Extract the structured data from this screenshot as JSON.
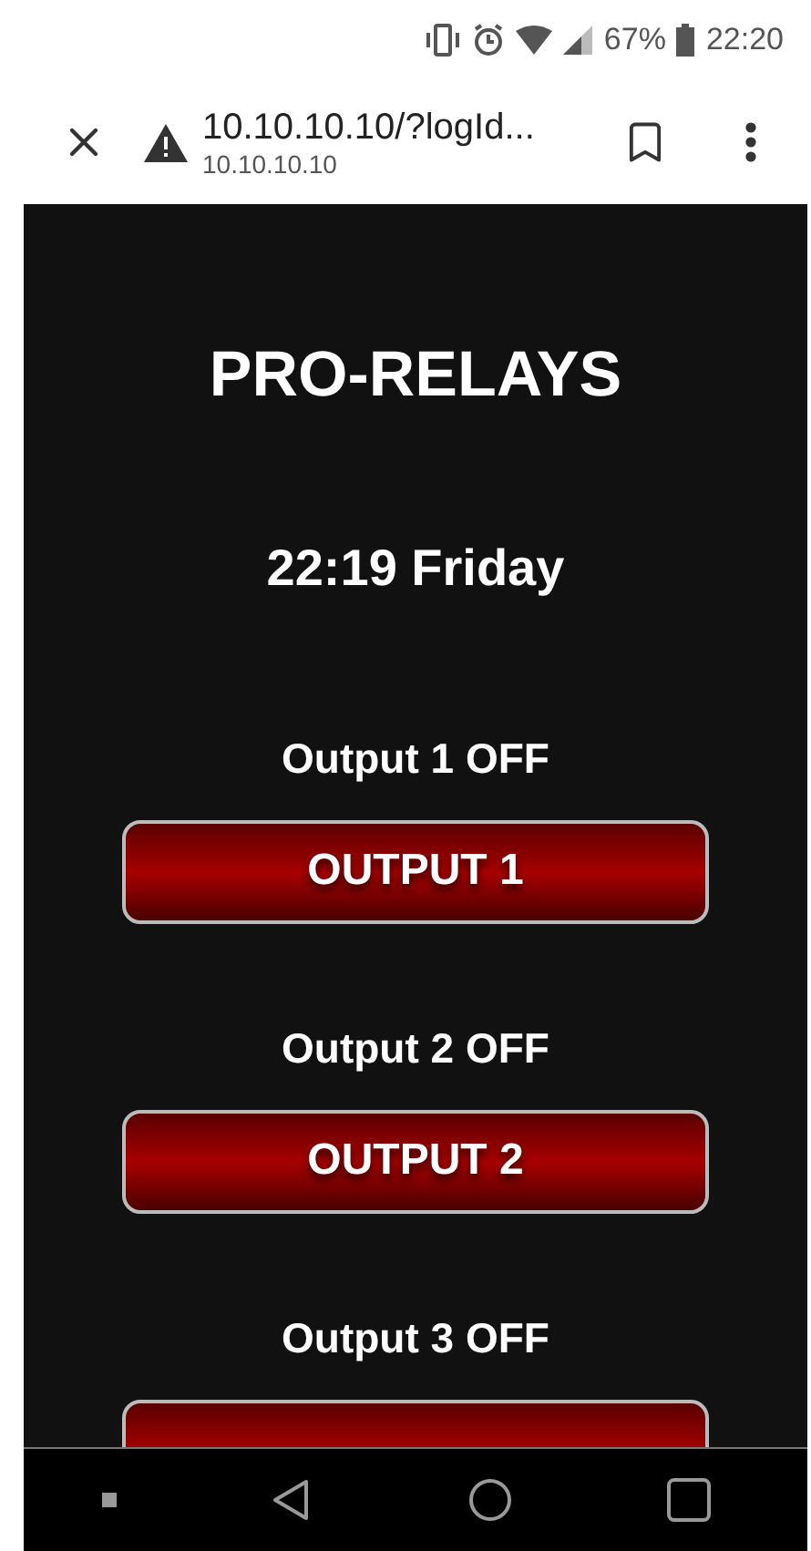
{
  "status_bar": {
    "battery": "67%",
    "time": "22:20"
  },
  "browser_toolbar": {
    "url": "10.10.10.10/?logId...",
    "host": "10.10.10.10"
  },
  "page": {
    "title": "PRO-RELAYS",
    "clock": "22:19 Friday",
    "outputs": [
      {
        "status": "Output 1 OFF",
        "button": "OUTPUT 1"
      },
      {
        "status": "Output 2 OFF",
        "button": "OUTPUT 2"
      },
      {
        "status": "Output 3 OFF"
      }
    ]
  }
}
